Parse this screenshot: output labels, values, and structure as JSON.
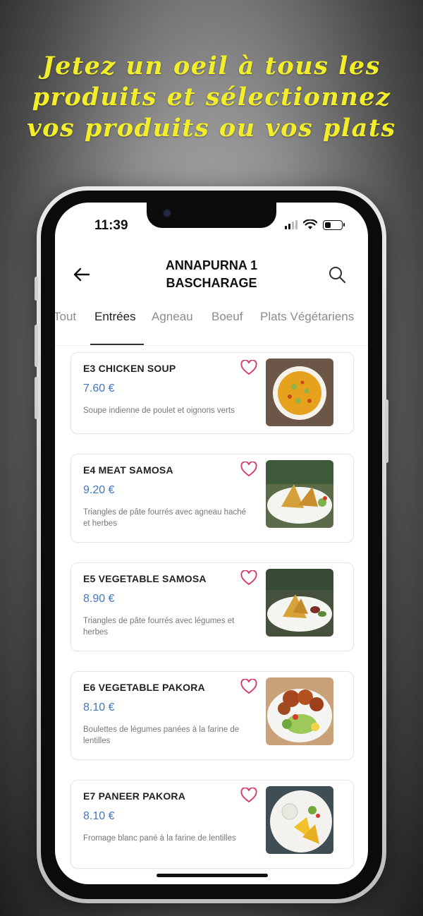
{
  "promo": {
    "lines": [
      "Jetez un oeil à tous les",
      "produits et sélectionnez",
      "vos produits ou vos plats"
    ]
  },
  "status_bar": {
    "time": "11:39"
  },
  "header": {
    "title_line1": "ANNAPURNA 1",
    "title_line2": "BASCHARAGE"
  },
  "tabs": [
    {
      "label": "Tout",
      "active": false
    },
    {
      "label": "Entrées",
      "active": true
    },
    {
      "label": "Agneau",
      "active": false
    },
    {
      "label": "Boeuf",
      "active": false
    },
    {
      "label": "Plats Végétariens",
      "active": false
    }
  ],
  "items": [
    {
      "name": "E3 CHICKEN SOUP",
      "price": "7.60 €",
      "desc": "Soupe indienne de poulet et oignons verts"
    },
    {
      "name": "E4 MEAT SAMOSA",
      "price": "9.20 €",
      "desc": "Triangles de pâte fourrés avec agneau haché et herbes"
    },
    {
      "name": "E5 VEGETABLE SAMOSA",
      "price": "8.90 €",
      "desc": "Triangles de pâte fourrés avec légumes et herbes"
    },
    {
      "name": "E6 VEGETABLE PAKORA",
      "price": "8.10 €",
      "desc": "Boulettes de légumes panées à la farine de lentilles"
    },
    {
      "name": "E7 PANEER PAKORA",
      "price": "8.10 €",
      "desc": "Fromage blanc pané à la farine de lentilles"
    }
  ],
  "colors": {
    "promo": "#f2ee2a",
    "price": "#3f78c0",
    "heart": "#d6336c"
  },
  "icons": [
    "back-arrow-icon",
    "search-icon",
    "heart-icon",
    "wifi-icon",
    "signal-icon",
    "battery-icon"
  ]
}
